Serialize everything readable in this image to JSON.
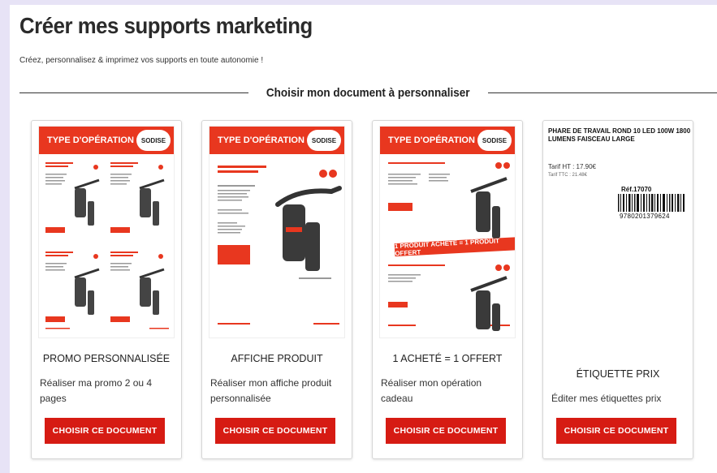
{
  "header": {
    "title": "Créer mes supports marketing",
    "subtitle": "Créez, personnalisez & imprimez vos supports en toute autonomie !"
  },
  "section": {
    "label": "Choisir mon document à personnaliser"
  },
  "cards": [
    {
      "name": "PROMO PERSONNALISÉE",
      "description": "Réaliser ma promo 2 ou 4 pages",
      "button_label": "CHOISIR CE DOCUMENT",
      "thumb_header": "TYPE D'OPÉRATION",
      "thumb_logo": "SODISE"
    },
    {
      "name": "AFFICHE PRODUIT",
      "description": "Réaliser mon affiche produit personnalisée",
      "button_label": "CHOISIR CE DOCUMENT",
      "thumb_header": "TYPE D'OPÉRATION",
      "thumb_logo": "SODISE"
    },
    {
      "name": "1 ACHETÉ = 1 OFFERT",
      "description": "Réaliser mon opération cadeau",
      "button_label": "CHOISIR CE DOCUMENT",
      "thumb_header": "TYPE D'OPÉRATION",
      "thumb_logo": "SODISE",
      "thumb_banner": "1 PRODUIT ACHETÉ = 1 PRODUIT OFFERT"
    },
    {
      "name": "ÉTIQUETTE PRIX",
      "description": "Éditer mes étiquettes prix",
      "button_label": "CHOISIR CE DOCUMENT",
      "label_title": "PHARE DE TRAVAIL ROND 10 LED 100W 1800 LUMENS FAISCEAU LARGE",
      "price_ht": "Tarif HT : 17.90€",
      "price_ttc": "Tarif TTC : 21.48€",
      "ref": "Réf.17070",
      "barcode": "9780201379624"
    }
  ],
  "colors": {
    "brand_red": "#d61b13",
    "header_red": "#e8371f",
    "background": "#e7e3f6"
  }
}
